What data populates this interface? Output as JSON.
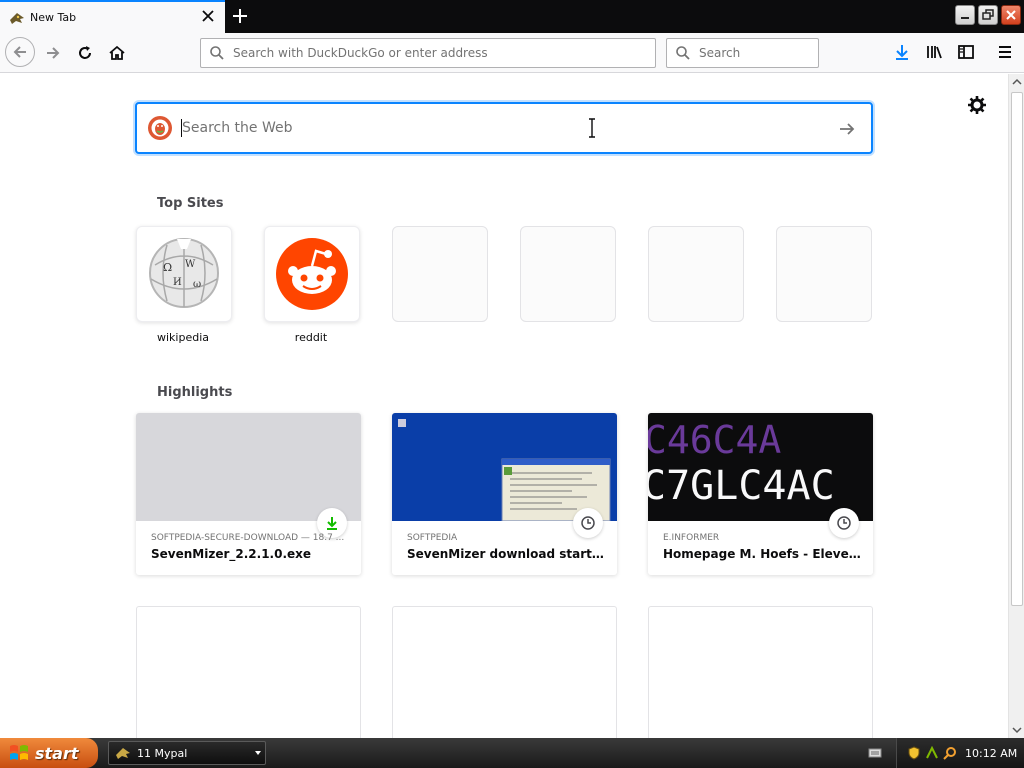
{
  "window": {
    "tab_title": "New Tab",
    "accent_color": "#0a84ff"
  },
  "navbar": {
    "url_placeholder": "Search with DuckDuckGo or enter address",
    "search_placeholder": "Search"
  },
  "newtab": {
    "web_search_placeholder": "Search the Web",
    "top_sites_title": "Top Sites",
    "top_sites": [
      {
        "label": "wikipedia",
        "icon": "wikipedia-logo-icon"
      },
      {
        "label": "reddit",
        "icon": "reddit-logo-icon"
      },
      {
        "label": "",
        "icon": ""
      },
      {
        "label": "",
        "icon": ""
      },
      {
        "label": "",
        "icon": ""
      },
      {
        "label": "",
        "icon": ""
      }
    ],
    "highlights_title": "Highlights",
    "highlights": [
      {
        "source": "SOFTPEDIA-SECURE-DOWNLOAD — 18.7 ...",
        "title": "SevenMizer_2.2.1.0.exe",
        "badge": "download-icon"
      },
      {
        "source": "SOFTPEDIA",
        "title": "SevenMizer download starting...",
        "badge": "clock-icon"
      },
      {
        "source": "E.INFORMER",
        "title": "Homepage M. Hoefs - ElevenMi...",
        "badge": "clock-icon",
        "thumb_text": "C7GLC4AC"
      }
    ]
  },
  "taskbar": {
    "start_label": "start",
    "task_label": "11 Mypal",
    "clock": "10:12 AM"
  }
}
